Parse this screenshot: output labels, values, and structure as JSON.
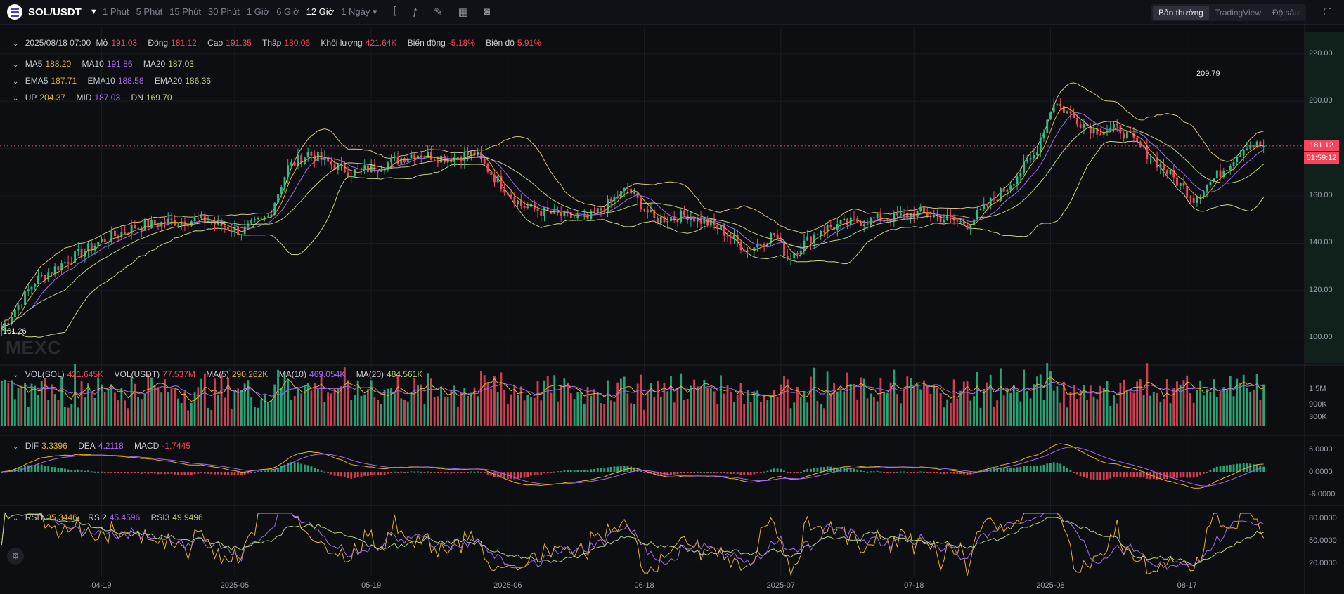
{
  "header": {
    "pair": "SOL/USDT",
    "timeframes": [
      "1 Phút",
      "5 Phút",
      "15 Phút",
      "30 Phút",
      "1 Giờ",
      "6 Giờ",
      "12 Giờ",
      "1 Ngày"
    ],
    "active_timeframe": "12 Giờ",
    "views": [
      "Bản thường",
      "TradingView",
      "Độ sâu"
    ],
    "active_view": "Bản thường"
  },
  "ohlc": {
    "date": "2025/08/18 07:00",
    "open_label": "Mở",
    "open": "191.03",
    "close_label": "Đóng",
    "close": "181.12",
    "high_label": "Cao",
    "high": "191.35",
    "low_label": "Thấp",
    "low": "180.06",
    "vol_label": "Khối lượng",
    "vol": "421.64K",
    "chg_label": "Biến động",
    "chg": "-5.18%",
    "amp_label": "Biên độ",
    "amp": "5.91%"
  },
  "ma": {
    "ma5_label": "MA5",
    "ma5": "188.20",
    "ma10_label": "MA10",
    "ma10": "191.86",
    "ma20_label": "MA20",
    "ma20": "187.03"
  },
  "ema": {
    "ema5_label": "EMA5",
    "ema5": "187.71",
    "ema10_label": "EMA10",
    "ema10": "188.58",
    "ema20_label": "EMA20",
    "ema20": "186.36"
  },
  "boll": {
    "up_label": "UP",
    "up": "204.37",
    "mid_label": "MID",
    "mid": "187.03",
    "dn_label": "DN",
    "dn": "169.70"
  },
  "volume": {
    "sol_label": "VOL(SOL)",
    "sol": "421.645K",
    "usdt_label": "VOL(USDT)",
    "usdt": "77.537M",
    "ma5_label": "MA(5)",
    "ma5": "290.262K",
    "ma10_label": "MA(10)",
    "ma10": "469.054K",
    "ma20_label": "MA(20)",
    "ma20": "484.561K"
  },
  "macd": {
    "dif_label": "DIF",
    "dif": "3.3396",
    "dea_label": "DEA",
    "dea": "4.2118",
    "macd_label": "MACD",
    "macd": "-1.7445"
  },
  "rsi": {
    "rsi1_label": "RSI1",
    "rsi1": "35.3446",
    "rsi2_label": "RSI2",
    "rsi2": "45.4596",
    "rsi3_label": "RSI3",
    "rsi3": "49.9496"
  },
  "price_axis": [
    "220.00",
    "200.00",
    "180.00",
    "160.00",
    "140.00",
    "120.00",
    "100.00"
  ],
  "volume_axis": [
    "1.5M",
    "900K",
    "300K"
  ],
  "macd_axis": [
    "6.0000",
    "0.0000",
    "-6.0000"
  ],
  "rsi_axis": [
    "80.0000",
    "50.0000",
    "20.0000"
  ],
  "date_axis": [
    "04-19",
    "2025-05",
    "05-19",
    "2025-06",
    "06-18",
    "2025-07",
    "07-18",
    "2025-08",
    "08-17"
  ],
  "last_price": "181.12",
  "countdown": "01:59:12",
  "high_marker": "209.79",
  "low_marker": "101.26",
  "watermark": "MEXC",
  "colors": {
    "up": "#2ebd85",
    "down": "#f6465d",
    "ma5": "#e6b422",
    "ma10": "#a569f0",
    "ma20": "#b5d17a"
  },
  "chart_data": {
    "type": "candlestick",
    "title": "SOL/USDT 12 Giờ",
    "ylim": [
      90,
      225
    ],
    "closes_anchor": [
      [
        0,
        104
      ],
      [
        10,
        124
      ],
      [
        20,
        133
      ],
      [
        30,
        141
      ],
      [
        40,
        147
      ],
      [
        50,
        149
      ],
      [
        60,
        150
      ],
      [
        72,
        145
      ],
      [
        80,
        151
      ],
      [
        86,
        172
      ],
      [
        92,
        178
      ],
      [
        98,
        174
      ],
      [
        105,
        170
      ],
      [
        112,
        172
      ],
      [
        124,
        178
      ],
      [
        134,
        176
      ],
      [
        142,
        178
      ],
      [
        148,
        168
      ],
      [
        156,
        156
      ],
      [
        166,
        152
      ],
      [
        176,
        150
      ],
      [
        188,
        163
      ],
      [
        196,
        150
      ],
      [
        206,
        152
      ],
      [
        216,
        146
      ],
      [
        224,
        137
      ],
      [
        232,
        144
      ],
      [
        236,
        134
      ],
      [
        246,
        146
      ],
      [
        256,
        149
      ],
      [
        268,
        151
      ],
      [
        276,
        153
      ],
      [
        290,
        148
      ],
      [
        302,
        164
      ],
      [
        310,
        177
      ],
      [
        316,
        200
      ],
      [
        322,
        193
      ],
      [
        328,
        188
      ],
      [
        336,
        188
      ],
      [
        348,
        173
      ],
      [
        358,
        159
      ],
      [
        366,
        170
      ],
      [
        374,
        182
      ],
      [
        379,
        181
      ]
    ],
    "x_range_bars": 380,
    "high": 209.79,
    "low": 101.26,
    "last_close": 181.12
  }
}
